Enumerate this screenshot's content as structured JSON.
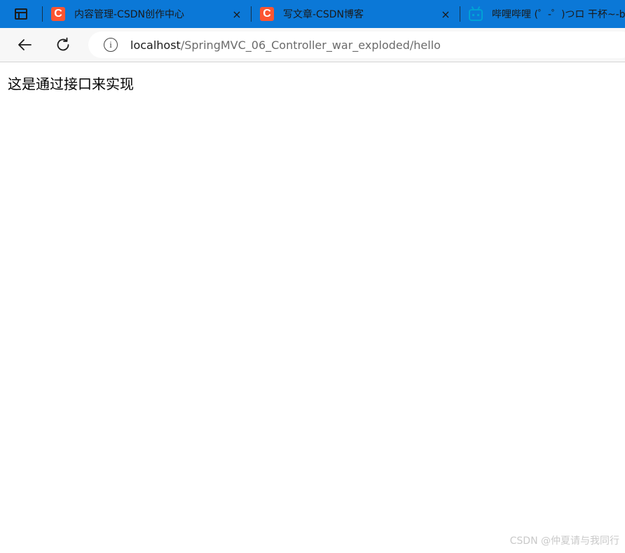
{
  "browser": {
    "tabs": [
      {
        "title": "内容管理-CSDN创作中心",
        "favicon": "C",
        "favicon_color": "#fc5531",
        "close": "×"
      },
      {
        "title": "写文章-CSDN博客",
        "favicon": "C",
        "favicon_color": "#fc5531",
        "close": "×"
      },
      {
        "title": "哔哩哔哩 (゜-゜)つロ 干杯~-bilibili",
        "favicon_icon": "bilibili-tv-icon",
        "favicon_color": "#00a1d6"
      }
    ],
    "address": {
      "host": "localhost",
      "path": "/SpringMVC_06_Controller_war_exploded/hello",
      "info_glyph": "i"
    },
    "icons": {
      "tab_actions": "window-tabs-icon",
      "back": "back-arrow-icon",
      "reload": "reload-icon"
    },
    "accent_color": "#0b78d7"
  },
  "page": {
    "message": "这是通过接口来实现"
  },
  "watermark": "CSDN @仲夏请与我同行"
}
